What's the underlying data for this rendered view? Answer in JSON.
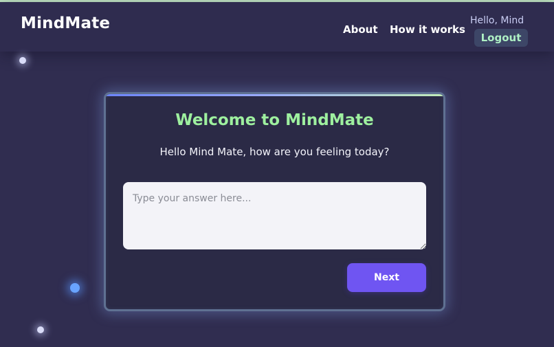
{
  "app": {
    "brand": "MindMate"
  },
  "header": {
    "nav": {
      "about": "About",
      "how_it_works": "How it works"
    },
    "user": {
      "greeting": "Hello, Mind",
      "logout_label": "Logout"
    }
  },
  "card": {
    "title": "Welcome to MindMate",
    "question": "Hello Mind Mate, how are you feeling today?",
    "answer": {
      "value": "",
      "placeholder": "Type your answer here..."
    },
    "next_label": "Next"
  },
  "colors": {
    "background": "#302d50",
    "title_green": "#9ef09f",
    "next_button": "#6f55f2",
    "logout_text": "#aef0c4"
  }
}
